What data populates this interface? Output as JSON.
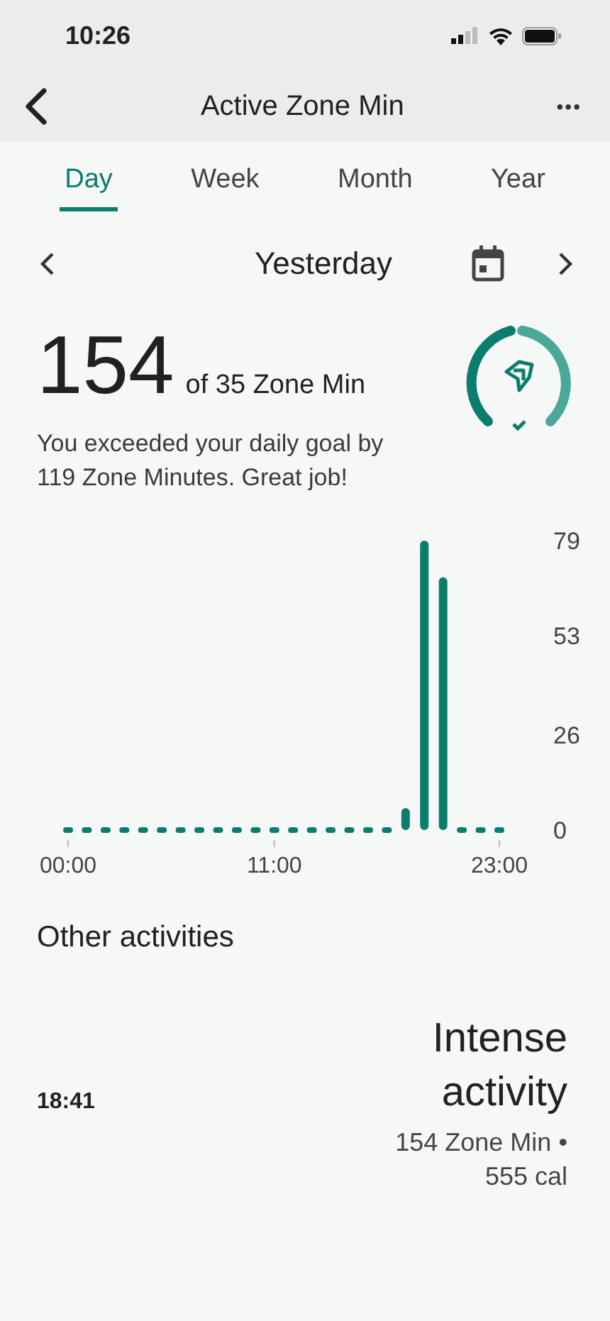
{
  "status_bar": {
    "time": "10:26"
  },
  "header": {
    "title": "Active Zone Min",
    "menu": "•••"
  },
  "tabs": [
    {
      "label": "Day",
      "selected": true
    },
    {
      "label": "Week",
      "selected": false
    },
    {
      "label": "Month",
      "selected": false
    },
    {
      "label": "Year",
      "selected": false
    }
  ],
  "date_nav": {
    "label": "Yesterday"
  },
  "summary": {
    "value": "154",
    "goal": "of 35 Zone Min",
    "message": "You exceeded your daily goal by 119 Zone Minutes. Great job!"
  },
  "chart": {
    "chart_data": {
      "type": "bar",
      "x": [
        0,
        1,
        2,
        3,
        4,
        5,
        6,
        7,
        8,
        9,
        10,
        11,
        12,
        13,
        14,
        15,
        16,
        17,
        18,
        19,
        20,
        21,
        22,
        23
      ],
      "values": [
        0,
        0,
        0,
        0,
        0,
        0,
        0,
        0,
        0,
        0,
        0,
        0,
        0,
        0,
        0,
        0,
        0,
        0,
        6,
        79,
        69,
        0,
        0,
        0
      ],
      "xlim": [
        0,
        23
      ],
      "ylim": [
        0,
        79
      ],
      "yticks": [
        0,
        26,
        53,
        79
      ],
      "xticks": [
        {
          "value": 0,
          "label": "00:00"
        },
        {
          "value": 11,
          "label": "11:00"
        },
        {
          "value": 23,
          "label": "23:00"
        }
      ]
    }
  },
  "other_activities": {
    "title": "Other activities",
    "items": [
      {
        "time": "18:41",
        "name": "Intense activity",
        "details": "154 Zone Min • 555 cal"
      }
    ]
  }
}
